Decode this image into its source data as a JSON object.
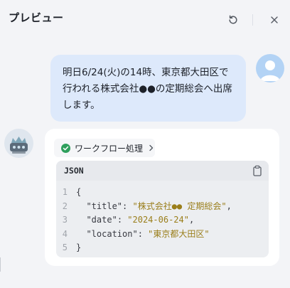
{
  "header": {
    "title": "プレビュー",
    "icons": {
      "refresh": "refresh-icon",
      "close": "close-icon"
    }
  },
  "user_message": {
    "text": "明日6/24(火)の14時、東京都大田区で行われる株式会社●●の定期総会へ出席します。",
    "avatar": "user-avatar-icon"
  },
  "bot_message": {
    "avatar": "bot-avatar-icon",
    "workflow_label": "ワークフロー処理",
    "workflow_status_icon": "check-circle-icon",
    "code": {
      "language": "JSON",
      "line_numbers": [
        "1",
        "2",
        "3",
        "4",
        "5"
      ],
      "open_brace": "{",
      "close_brace": "}",
      "entries": [
        {
          "key": "\"title\"",
          "value": "\"株式会社●● 定期総会\"",
          "trail": ","
        },
        {
          "key": "\"date\"",
          "value": "\"2024-06-24\"",
          "trail": ","
        },
        {
          "key": "\"location\"",
          "value": "\"東京都大田区\"",
          "trail": ""
        }
      ]
    }
  },
  "colors": {
    "user_bubble": "#dde9fb",
    "string": "#9a7e1a",
    "success": "#2e9f5c"
  }
}
